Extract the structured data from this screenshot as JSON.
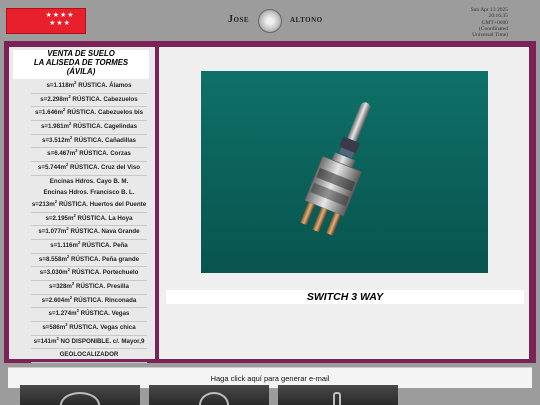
{
  "header": {
    "first_name": "Jose",
    "last_name": "altono",
    "clock_lines": [
      "Sun Apr 13 2025",
      "20:16:35",
      "GMT+0000",
      "(Coordinated",
      "Universal Time)"
    ]
  },
  "sidebar": {
    "title_lines": [
      "VENTA DE SUELO",
      "LA ALISEDA DE TORMES",
      "(ÁVILA)"
    ],
    "items": [
      {
        "prefix": "s=1.118m",
        "sup": "2",
        "suffix": " RÚSTICA. Álamos"
      },
      {
        "prefix": "s=2.298m",
        "sup": "2",
        "suffix": " RÚSTICA. Cabezuelos"
      },
      {
        "prefix": "s=1.646m",
        "sup": "2",
        "suffix": " RÚSTICA. Cabezuelos bis"
      },
      {
        "prefix": "s=1.981m",
        "sup": "2",
        "suffix": " RÚSTICA. Cagelindas"
      },
      {
        "prefix": "s=3.512m",
        "sup": "2",
        "suffix": " RÚSTICA. Cañadillas"
      },
      {
        "prefix": "s=6.467m",
        "sup": "2",
        "suffix": " RÚSTICA. Corzas"
      },
      {
        "prefix": "s=5.744m",
        "sup": "2",
        "suffix": " RÚSTICA. Cruz del Viso"
      },
      {
        "prefix": "Encinas Hdros. Cayo B. M.",
        "sup": "",
        "suffix": ""
      },
      {
        "prefix": "Encinas Hdros. Francisco B. L.",
        "sup": "",
        "suffix": ""
      },
      {
        "prefix": "s=213m",
        "sup": "2",
        "suffix": " RÚSTICA. Huertos del Puente"
      },
      {
        "prefix": "s=2.195m",
        "sup": "2",
        "suffix": " RÚSTICA. La Hoya"
      },
      {
        "prefix": "s=1.077m",
        "sup": "2",
        "suffix": " RÚSTICA. Nava Grande"
      },
      {
        "prefix": "s=1.116m",
        "sup": "2",
        "suffix": " RÚSTICA. Peña"
      },
      {
        "prefix": "s=8.558m",
        "sup": "2",
        "suffix": " RÚSTICA. Peña grande"
      },
      {
        "prefix": "s=3.030m",
        "sup": "2",
        "suffix": " RÚSTICA. Portechuelo"
      },
      {
        "prefix": "s=328m",
        "sup": "2",
        "suffix": " RÚSTICA. Presilla"
      },
      {
        "prefix": "s=2.604m",
        "sup": "2",
        "suffix": " RÚSTICA. Rinconada"
      },
      {
        "prefix": "s=1.274m",
        "sup": "2",
        "suffix": " RÚSTICA. Vegas"
      },
      {
        "prefix": "s=586m",
        "sup": "2",
        "suffix": " RÚSTICA. Vegas chica"
      },
      {
        "prefix": "s=141m",
        "sup": "2",
        "suffix": " NO DISPONIBLE. c/. Mayor,9"
      },
      {
        "prefix": "GEOLOCALIZADOR",
        "sup": "",
        "suffix": ""
      }
    ]
  },
  "main": {
    "product_title": "SWITCH 3 WAY",
    "email_link": "Haga click aquí para generar e-mail"
  },
  "colors": {
    "frame": "#7c2257",
    "flag_red": "#e8202c",
    "product_bg": "#0e7168"
  },
  "icons": [
    "madrid-flag-logo",
    "crest-icon",
    "toggle-switch-image"
  ]
}
